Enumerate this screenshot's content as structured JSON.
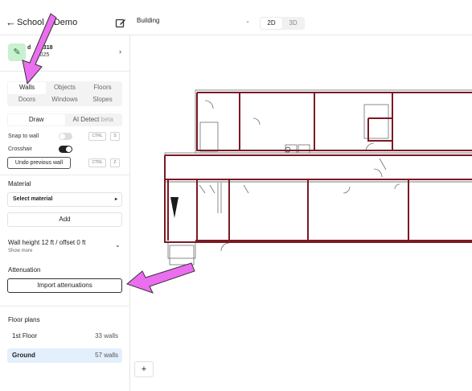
{
  "header": {
    "back_glyph": "←",
    "project_title": "School    Demo",
    "edit_icon": "edit-square-icon",
    "floor_select": {
      "value": "Building",
      "chevron": "⌄"
    },
    "view_modes": [
      "2D",
      "3D"
    ],
    "active_view": "2D"
  },
  "sidebar": {
    "account": {
      "icon": "pencil-icon",
      "line1": "d    #2318",
      "line2": "      2025",
      "chevron": "›"
    },
    "tools": [
      {
        "label": "Walls",
        "active": true
      },
      {
        "label": "Objects",
        "active": false
      },
      {
        "label": "Floors",
        "active": false
      },
      {
        "label": "Doors",
        "active": false
      },
      {
        "label": "Windows",
        "active": false
      },
      {
        "label": "Slopes",
        "active": false
      }
    ],
    "modes": {
      "draw": "Draw",
      "ai_detect": "AI Detect",
      "beta": "beta"
    },
    "snap_to_wall": {
      "label": "Snap to wall",
      "enabled": false,
      "shortcut": [
        "CTRL",
        "S"
      ]
    },
    "crosshair": {
      "label": "Crosshair",
      "enabled": true
    },
    "undo": {
      "label": "Undo previous wall",
      "shortcut": [
        "CTRL",
        "Z"
      ]
    },
    "material": {
      "section": "Material",
      "select_label": "Select material",
      "select_arrow": "▸",
      "add_label": "Add"
    },
    "wall_height": {
      "label": "Wall height 12 ft / offset 0 ft",
      "show_more": "Show more",
      "chevron": "⌄"
    },
    "attenuation": {
      "section": "Attenuation",
      "import_label": "Import attenuations"
    },
    "floor_plans": {
      "section": "Floor plans",
      "items": [
        {
          "name": "1st Floor",
          "count": "33 walls",
          "active": false
        },
        {
          "name": "Ground",
          "count": "57 walls",
          "active": true
        }
      ]
    }
  },
  "canvas": {
    "zoom_in_label": "+"
  },
  "colors": {
    "wall": "#7a1a24",
    "annotation_arrow": "#ec6ef0",
    "active_floor_bg": "#e3effc"
  }
}
